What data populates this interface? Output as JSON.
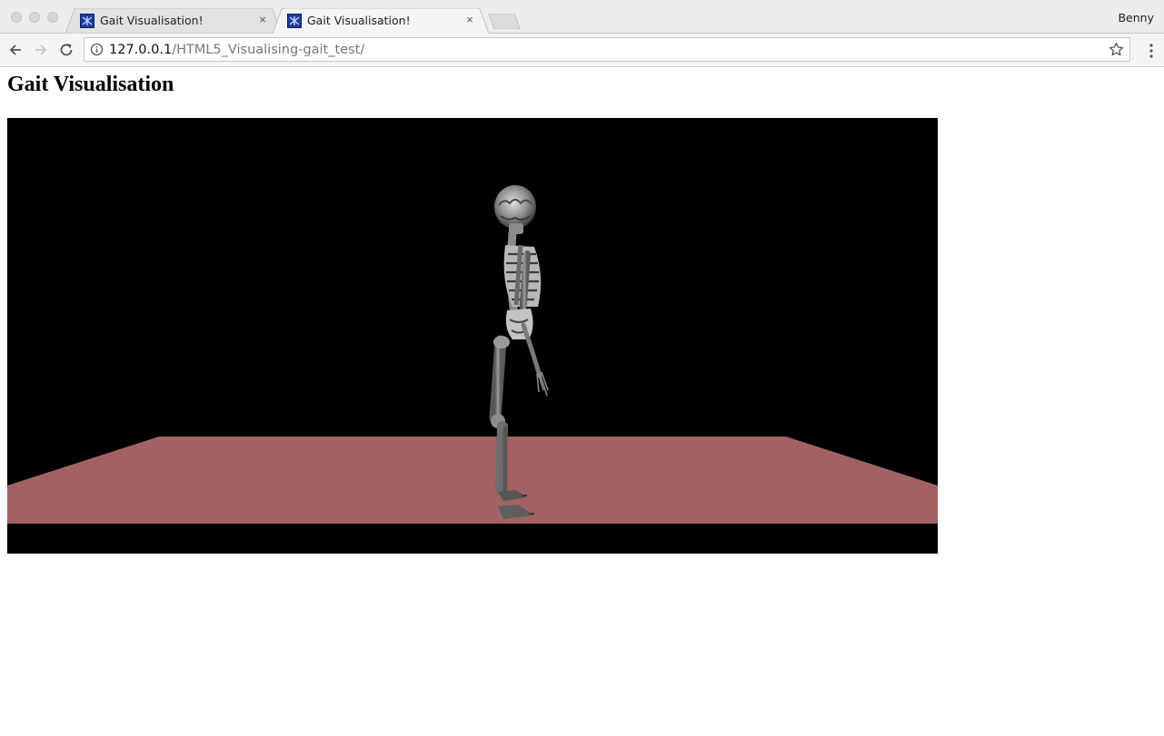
{
  "browser": {
    "tabs": [
      {
        "title": "Gait Visualisation!",
        "active": false
      },
      {
        "title": "Gait Visualisation!",
        "active": true
      }
    ],
    "profile_name": "Benny",
    "url_host": "127.0.0.1",
    "url_path": "/HTML5_Visualising-gait_test/"
  },
  "page": {
    "heading": "Gait Visualisation"
  },
  "scene": {
    "background_color": "#000000",
    "floor_color": "#a26264",
    "figure": "skeleton",
    "figure_colors": [
      "#9a9a9a",
      "#6e6e6e",
      "#d8d8d8"
    ]
  },
  "icons": [
    "favicon-icon",
    "close-icon",
    "back-arrow-icon",
    "forward-arrow-icon",
    "reload-icon",
    "info-icon",
    "bookmark-star-icon",
    "menu-kebab-icon"
  ]
}
